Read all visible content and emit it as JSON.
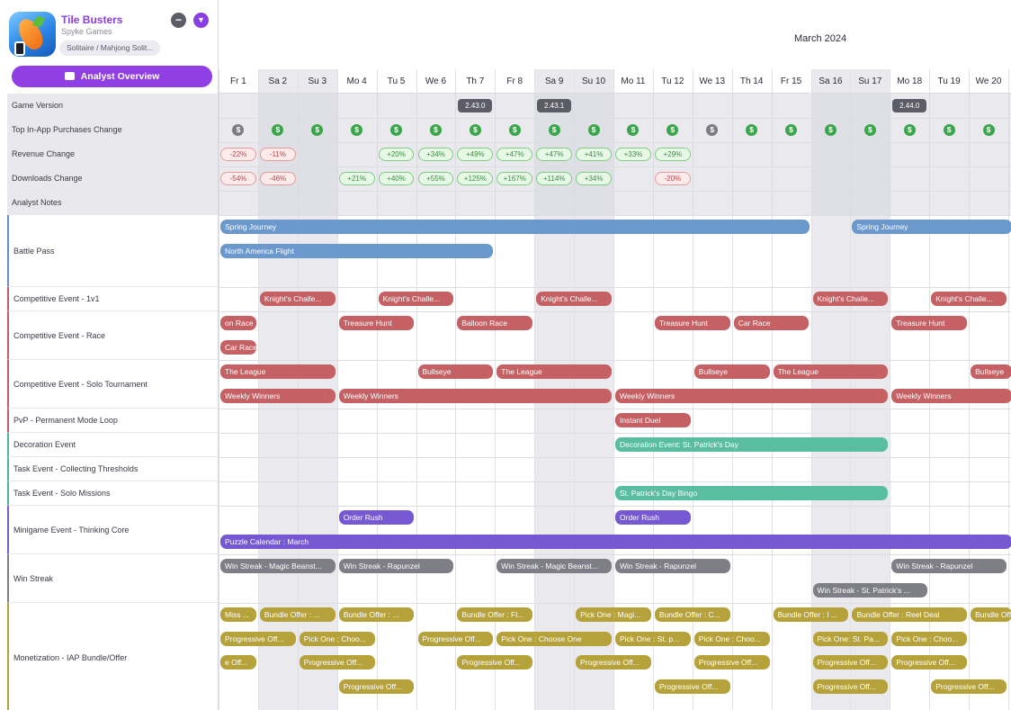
{
  "app": {
    "name": "Tile Busters",
    "developer": "Spyke Games",
    "genre": "Solitaire / Mahjong Solit...",
    "analyst_button": "Analyst Overview"
  },
  "calendar": {
    "month": "March 2024",
    "days": [
      {
        "label": "Fr 1",
        "weekend": false
      },
      {
        "label": "Sa 2",
        "weekend": true
      },
      {
        "label": "Su 3",
        "weekend": true
      },
      {
        "label": "Mo 4",
        "weekend": false
      },
      {
        "label": "Tu 5",
        "weekend": false
      },
      {
        "label": "We 6",
        "weekend": false
      },
      {
        "label": "Th 7",
        "weekend": false
      },
      {
        "label": "Fr 8",
        "weekend": false
      },
      {
        "label": "Sa 9",
        "weekend": true
      },
      {
        "label": "Su 10",
        "weekend": true
      },
      {
        "label": "Mo 11",
        "weekend": false
      },
      {
        "label": "Tu 12",
        "weekend": false
      },
      {
        "label": "We 13",
        "weekend": false
      },
      {
        "label": "Th 14",
        "weekend": false
      },
      {
        "label": "Fr 15",
        "weekend": false
      },
      {
        "label": "Sa 16",
        "weekend": true
      },
      {
        "label": "Su 17",
        "weekend": true
      },
      {
        "label": "Mo 18",
        "weekend": false
      },
      {
        "label": "Tu 19",
        "weekend": false
      },
      {
        "label": "We 20",
        "weekend": false
      },
      {
        "label": "T",
        "weekend": false
      }
    ]
  },
  "rows": [
    {
      "label": "Game Version",
      "accent": "none"
    },
    {
      "label": "Top In-App Purchases Change",
      "accent": "none"
    },
    {
      "label": "Revenue Change",
      "accent": "none"
    },
    {
      "label": "Downloads Change",
      "accent": "none"
    },
    {
      "label": "Analyst Notes",
      "accent": "none"
    },
    {
      "label": "Battle Pass",
      "accent": "blue"
    },
    {
      "label": "Competitive Event - 1v1",
      "accent": "red"
    },
    {
      "label": "Competitive Event - Race",
      "accent": "red"
    },
    {
      "label": "Competitive Event - Solo Tournament",
      "accent": "red"
    },
    {
      "label": "PvP - Permanent Mode Loop",
      "accent": "red"
    },
    {
      "label": "Decoration Event",
      "accent": "teal"
    },
    {
      "label": "Task Event - Collecting Thresholds",
      "accent": "teal"
    },
    {
      "label": "Task Event - Solo Missions",
      "accent": "teal"
    },
    {
      "label": "Minigame Event - Thinking Core",
      "accent": "purple"
    },
    {
      "label": "Win Streak",
      "accent": "gray"
    },
    {
      "label": "Monetization - IAP Bundle/Offer",
      "accent": "gold"
    }
  ],
  "versions": [
    {
      "day": 6,
      "text": "2.43.0"
    },
    {
      "day": 8,
      "text": "2.43.1"
    },
    {
      "day": 17,
      "text": "2.44.0"
    }
  ],
  "iap_coins": [
    {
      "day": 0,
      "status": "gray",
      "glyph": "$"
    },
    {
      "day": 1,
      "status": "green",
      "glyph": "$"
    },
    {
      "day": 2,
      "status": "green",
      "glyph": "$"
    },
    {
      "day": 3,
      "status": "green",
      "glyph": "$"
    },
    {
      "day": 4,
      "status": "green",
      "glyph": "$"
    },
    {
      "day": 5,
      "status": "green",
      "glyph": "$"
    },
    {
      "day": 6,
      "status": "green",
      "glyph": "$"
    },
    {
      "day": 7,
      "status": "green",
      "glyph": "$"
    },
    {
      "day": 8,
      "status": "green",
      "glyph": "$"
    },
    {
      "day": 9,
      "status": "green",
      "glyph": "$"
    },
    {
      "day": 10,
      "status": "green",
      "glyph": "$"
    },
    {
      "day": 11,
      "status": "green",
      "glyph": "$"
    },
    {
      "day": 12,
      "status": "gray",
      "glyph": "$"
    },
    {
      "day": 13,
      "status": "green",
      "glyph": "$"
    },
    {
      "day": 14,
      "status": "green",
      "glyph": "$"
    },
    {
      "day": 15,
      "status": "green",
      "glyph": "$"
    },
    {
      "day": 16,
      "status": "green",
      "glyph": "$"
    },
    {
      "day": 17,
      "status": "green",
      "glyph": "$"
    },
    {
      "day": 18,
      "status": "green",
      "glyph": "$"
    },
    {
      "day": 19,
      "status": "green",
      "glyph": "$"
    }
  ],
  "revenue_change": [
    {
      "day": 0,
      "text": "-22%",
      "tone": "neg"
    },
    {
      "day": 1,
      "text": "-11%",
      "tone": "neg"
    },
    {
      "day": 4,
      "text": "+20%",
      "tone": "pos"
    },
    {
      "day": 5,
      "text": "+34%",
      "tone": "pos"
    },
    {
      "day": 6,
      "text": "+49%",
      "tone": "pos"
    },
    {
      "day": 7,
      "text": "+47%",
      "tone": "pos"
    },
    {
      "day": 8,
      "text": "+47%",
      "tone": "pos"
    },
    {
      "day": 9,
      "text": "+41%",
      "tone": "pos"
    },
    {
      "day": 10,
      "text": "+33%",
      "tone": "pos"
    },
    {
      "day": 11,
      "text": "+29%",
      "tone": "pos"
    }
  ],
  "downloads_change": [
    {
      "day": 0,
      "text": "-54%",
      "tone": "neg"
    },
    {
      "day": 1,
      "text": "-46%",
      "tone": "neg"
    },
    {
      "day": 3,
      "text": "+21%",
      "tone": "pos"
    },
    {
      "day": 4,
      "text": "+40%",
      "tone": "pos"
    },
    {
      "day": 5,
      "text": "+55%",
      "tone": "pos"
    },
    {
      "day": 6,
      "text": "+125%",
      "tone": "pos"
    },
    {
      "day": 7,
      "text": "+167%",
      "tone": "pos"
    },
    {
      "day": 8,
      "text": "+114%",
      "tone": "pos"
    },
    {
      "day": 9,
      "text": "+34%",
      "tone": "pos"
    },
    {
      "day": 11,
      "text": "-20%",
      "tone": "neg"
    }
  ],
  "events": [
    {
      "row": 5,
      "lane": 0,
      "start": 0,
      "end": 15,
      "text": "Spring Journey",
      "color": "blue"
    },
    {
      "row": 5,
      "lane": 0,
      "start": 16,
      "end": 21,
      "text": "Spring Journey",
      "color": "blue"
    },
    {
      "row": 5,
      "lane": 1,
      "start": 0,
      "end": 7,
      "text": "North America Flight",
      "color": "blue"
    },
    {
      "row": 6,
      "lane": 0,
      "start": 1,
      "end": 3,
      "text": "Knight's Challe...",
      "color": "red"
    },
    {
      "row": 6,
      "lane": 0,
      "start": 4,
      "end": 6,
      "text": "Knight's Challe...",
      "color": "red"
    },
    {
      "row": 6,
      "lane": 0,
      "start": 8,
      "end": 10,
      "text": "Knight's Challe...",
      "color": "red"
    },
    {
      "row": 6,
      "lane": 0,
      "start": 15,
      "end": 17,
      "text": "Knight's Challe...",
      "color": "red"
    },
    {
      "row": 6,
      "lane": 0,
      "start": 18,
      "end": 20,
      "text": "Knight's Challe...",
      "color": "red"
    },
    {
      "row": 7,
      "lane": 0,
      "start": 0,
      "end": 1,
      "text": "on Race",
      "color": "red"
    },
    {
      "row": 7,
      "lane": 0,
      "start": 3,
      "end": 5,
      "text": "Treasure Hunt",
      "color": "red"
    },
    {
      "row": 7,
      "lane": 0,
      "start": 6,
      "end": 8,
      "text": "Balloon Race",
      "color": "red"
    },
    {
      "row": 7,
      "lane": 0,
      "start": 11,
      "end": 13,
      "text": "Treasure Hunt",
      "color": "red"
    },
    {
      "row": 7,
      "lane": 0,
      "start": 13,
      "end": 15,
      "text": "Car Race",
      "color": "red"
    },
    {
      "row": 7,
      "lane": 0,
      "start": 17,
      "end": 19,
      "text": "Treasure Hunt",
      "color": "red"
    },
    {
      "row": 7,
      "lane": 1,
      "start": 0,
      "end": 1,
      "text": "Car Race",
      "color": "red"
    },
    {
      "row": 8,
      "lane": 0,
      "start": 0,
      "end": 3,
      "text": "The League",
      "color": "red"
    },
    {
      "row": 8,
      "lane": 0,
      "start": 5,
      "end": 7,
      "text": "Bullseye",
      "color": "red"
    },
    {
      "row": 8,
      "lane": 0,
      "start": 7,
      "end": 10,
      "text": "The League",
      "color": "red"
    },
    {
      "row": 8,
      "lane": 0,
      "start": 12,
      "end": 14,
      "text": "Bullseye",
      "color": "red"
    },
    {
      "row": 8,
      "lane": 0,
      "start": 14,
      "end": 17,
      "text": "The League",
      "color": "red"
    },
    {
      "row": 8,
      "lane": 0,
      "start": 19,
      "end": 21,
      "text": "Bullseye",
      "color": "red"
    },
    {
      "row": 8,
      "lane": 1,
      "start": 0,
      "end": 3,
      "text": "Weekly Winners",
      "color": "red"
    },
    {
      "row": 8,
      "lane": 1,
      "start": 3,
      "end": 10,
      "text": "Weekly Winners",
      "color": "red"
    },
    {
      "row": 8,
      "lane": 1,
      "start": 10,
      "end": 17,
      "text": "Weekly Winners",
      "color": "red"
    },
    {
      "row": 8,
      "lane": 1,
      "start": 17,
      "end": 21,
      "text": "Weekly Winners",
      "color": "red"
    },
    {
      "row": 9,
      "lane": 0,
      "start": 10,
      "end": 12,
      "text": "Instant Duel",
      "color": "red"
    },
    {
      "row": 10,
      "lane": 0,
      "start": 10,
      "end": 17,
      "text": "Decoration Event: St. Patrick's Day",
      "color": "teal"
    },
    {
      "row": 12,
      "lane": 0,
      "start": 10,
      "end": 17,
      "text": "St. Patrick's Day Bingo",
      "color": "teal"
    },
    {
      "row": 13,
      "lane": 0,
      "start": 3,
      "end": 5,
      "text": "Order Rush",
      "color": "purple"
    },
    {
      "row": 13,
      "lane": 0,
      "start": 10,
      "end": 12,
      "text": "Order Rush",
      "color": "purple"
    },
    {
      "row": 13,
      "lane": 1,
      "start": 0,
      "end": 21,
      "text": "Puzzle Calendar : March",
      "color": "purple"
    },
    {
      "row": 14,
      "lane": 0,
      "start": 0,
      "end": 3,
      "text": "Win Streak - Magic Beanst...",
      "color": "gray"
    },
    {
      "row": 14,
      "lane": 0,
      "start": 3,
      "end": 6,
      "text": "Win Streak - Rapunzel",
      "color": "gray"
    },
    {
      "row": 14,
      "lane": 0,
      "start": 7,
      "end": 10,
      "text": "Win Streak - Magic Beanst...",
      "color": "gray"
    },
    {
      "row": 14,
      "lane": 0,
      "start": 10,
      "end": 13,
      "text": "Win Streak - Rapunzel",
      "color": "gray"
    },
    {
      "row": 14,
      "lane": 0,
      "start": 17,
      "end": 20,
      "text": "Win Streak - Rapunzel",
      "color": "gray"
    },
    {
      "row": 14,
      "lane": 1,
      "start": 15,
      "end": 18,
      "text": "Win Streak - St. Patrick's ...",
      "color": "gray"
    },
    {
      "row": 15,
      "lane": 0,
      "start": 0,
      "end": 1,
      "text": "Miss ...",
      "color": "gold"
    },
    {
      "row": 15,
      "lane": 0,
      "start": 1,
      "end": 3,
      "text": "Bundle Offer : ...",
      "color": "gold"
    },
    {
      "row": 15,
      "lane": 0,
      "start": 3,
      "end": 5,
      "text": "Bundle Offer : ...",
      "color": "gold"
    },
    {
      "row": 15,
      "lane": 0,
      "start": 6,
      "end": 8,
      "text": "Bundle Offer : Fl...",
      "color": "gold"
    },
    {
      "row": 15,
      "lane": 0,
      "start": 9,
      "end": 11,
      "text": "Pick One : Magi...",
      "color": "gold"
    },
    {
      "row": 15,
      "lane": 0,
      "start": 11,
      "end": 13,
      "text": "Bundle Offer : C...",
      "color": "gold"
    },
    {
      "row": 15,
      "lane": 0,
      "start": 14,
      "end": 16,
      "text": "Bundle Offer : I ...",
      "color": "gold"
    },
    {
      "row": 15,
      "lane": 0,
      "start": 16,
      "end": 19,
      "text": "Bundle Offer : Reel Deal",
      "color": "gold"
    },
    {
      "row": 15,
      "lane": 0,
      "start": 19,
      "end": 21,
      "text": "Bundle Offer",
      "color": "gold"
    },
    {
      "row": 15,
      "lane": 1,
      "start": 0,
      "end": 2,
      "text": "Progressive Off...",
      "color": "gold"
    },
    {
      "row": 15,
      "lane": 1,
      "start": 2,
      "end": 4,
      "text": "Pick One : Choo...",
      "color": "gold"
    },
    {
      "row": 15,
      "lane": 1,
      "start": 5,
      "end": 7,
      "text": "Progressive Off...",
      "color": "gold"
    },
    {
      "row": 15,
      "lane": 1,
      "start": 7,
      "end": 10,
      "text": "Pick One : Choose One",
      "color": "gold"
    },
    {
      "row": 15,
      "lane": 1,
      "start": 10,
      "end": 12,
      "text": "Pick One : St. p...",
      "color": "gold"
    },
    {
      "row": 15,
      "lane": 1,
      "start": 12,
      "end": 14,
      "text": "Pick One : Choo...",
      "color": "gold"
    },
    {
      "row": 15,
      "lane": 1,
      "start": 15,
      "end": 17,
      "text": "Pick One: St. Pa...",
      "color": "gold"
    },
    {
      "row": 15,
      "lane": 1,
      "start": 17,
      "end": 19,
      "text": "Pick One : Choo...",
      "color": "gold"
    },
    {
      "row": 15,
      "lane": 2,
      "start": 0,
      "end": 1,
      "text": "e Off...",
      "color": "gold"
    },
    {
      "row": 15,
      "lane": 2,
      "start": 2,
      "end": 4,
      "text": "Progressive Off...",
      "color": "gold"
    },
    {
      "row": 15,
      "lane": 2,
      "start": 6,
      "end": 8,
      "text": "Progressive Off...",
      "color": "gold"
    },
    {
      "row": 15,
      "lane": 2,
      "start": 9,
      "end": 11,
      "text": "Progressive Off...",
      "color": "gold"
    },
    {
      "row": 15,
      "lane": 2,
      "start": 12,
      "end": 14,
      "text": "Progressive Off...",
      "color": "gold"
    },
    {
      "row": 15,
      "lane": 2,
      "start": 15,
      "end": 17,
      "text": "Progressive Off...",
      "color": "gold"
    },
    {
      "row": 15,
      "lane": 2,
      "start": 17,
      "end": 19,
      "text": "Progressive Off...",
      "color": "gold"
    },
    {
      "row": 15,
      "lane": 3,
      "start": 3,
      "end": 5,
      "text": "Progressive Off...",
      "color": "gold"
    },
    {
      "row": 15,
      "lane": 3,
      "start": 11,
      "end": 13,
      "text": "Progressive Off...",
      "color": "gold"
    },
    {
      "row": 15,
      "lane": 3,
      "start": 15,
      "end": 17,
      "text": "Progressive Off...",
      "color": "gold"
    },
    {
      "row": 15,
      "lane": 3,
      "start": 18,
      "end": 20,
      "text": "Progressive Off...",
      "color": "gold"
    }
  ]
}
